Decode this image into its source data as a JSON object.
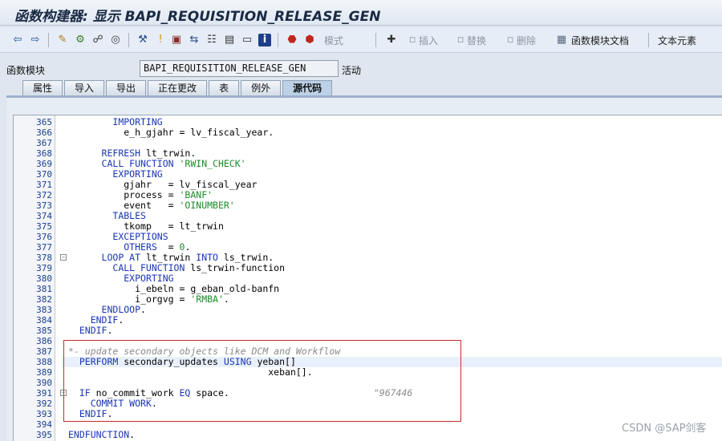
{
  "window": {
    "title": "函数构建器: 显示 BAPI_REQUISITION_RELEASE_GEN"
  },
  "toolbar": {
    "mode_label": "模式",
    "insert_label": "插入",
    "replace_label": "替换",
    "delete_label": "删除",
    "docs_label": "函数模块文档",
    "text_elements_label": "文本元素"
  },
  "header": {
    "field_label": "函数模块",
    "function_name": "BAPI_REQUISITION_RELEASE_GEN",
    "status": "活动"
  },
  "tabs": [
    {
      "label": "属性"
    },
    {
      "label": "导入"
    },
    {
      "label": "导出"
    },
    {
      "label": "正在更改"
    },
    {
      "label": "表"
    },
    {
      "label": "例外"
    },
    {
      "label": "源代码"
    }
  ],
  "active_tab": "源代码",
  "editor": {
    "line_numbers": [
      "365",
      "366",
      "367",
      "368",
      "369",
      "370",
      "371",
      "372",
      "373",
      "374",
      "375",
      "376",
      "377",
      "378",
      "379",
      "380",
      "381",
      "382",
      "383",
      "384",
      "385",
      "386",
      "387",
      "388",
      "389",
      "390",
      "391",
      "392",
      "393",
      "394",
      "395"
    ],
    "lines": [
      {
        "indent": "        ",
        "parts": [
          {
            "t": "IMPORTING",
            "c": "kw"
          }
        ]
      },
      {
        "indent": "          ",
        "parts": [
          {
            "t": "e_h_gjahr = lv_fiscal_year.",
            "c": ""
          }
        ]
      },
      {
        "indent": "",
        "parts": []
      },
      {
        "indent": "      ",
        "parts": [
          {
            "t": "REFRESH",
            "c": "kw"
          },
          {
            "t": " lt_trwin.",
            "c": ""
          }
        ]
      },
      {
        "indent": "      ",
        "parts": [
          {
            "t": "CALL FUNCTION",
            "c": "kw"
          },
          {
            "t": " ",
            "c": ""
          },
          {
            "t": "'RWIN_CHECK'",
            "c": "str"
          }
        ]
      },
      {
        "indent": "        ",
        "parts": [
          {
            "t": "EXPORTING",
            "c": "kw"
          }
        ]
      },
      {
        "indent": "          ",
        "parts": [
          {
            "t": "gjahr   = lv_fiscal_year",
            "c": ""
          }
        ]
      },
      {
        "indent": "          ",
        "parts": [
          {
            "t": "process = ",
            "c": ""
          },
          {
            "t": "'BANF'",
            "c": "str"
          }
        ]
      },
      {
        "indent": "          ",
        "parts": [
          {
            "t": "event   = ",
            "c": ""
          },
          {
            "t": "'OINUMBER'",
            "c": "str"
          }
        ]
      },
      {
        "indent": "        ",
        "parts": [
          {
            "t": "TABLES",
            "c": "kw"
          }
        ]
      },
      {
        "indent": "          ",
        "parts": [
          {
            "t": "tkomp   = lt_trwin",
            "c": ""
          }
        ]
      },
      {
        "indent": "        ",
        "parts": [
          {
            "t": "EXCEPTIONS",
            "c": "kw"
          }
        ]
      },
      {
        "indent": "          ",
        "parts": [
          {
            "t": "OTHERS",
            "c": "kw"
          },
          {
            "t": "  = ",
            "c": ""
          },
          {
            "t": "0",
            "c": "str"
          },
          {
            "t": ".",
            "c": ""
          }
        ]
      },
      {
        "indent": "      ",
        "parts": [
          {
            "t": "LOOP AT",
            "c": "kw"
          },
          {
            "t": " lt_trwin ",
            "c": ""
          },
          {
            "t": "INTO",
            "c": "kw"
          },
          {
            "t": " ls_trwin.",
            "c": ""
          }
        ]
      },
      {
        "indent": "        ",
        "parts": [
          {
            "t": "CALL FUNCTION",
            "c": "kw"
          },
          {
            "t": " ls_trwin-function",
            "c": ""
          }
        ]
      },
      {
        "indent": "          ",
        "parts": [
          {
            "t": "EXPORTING",
            "c": "kw"
          }
        ]
      },
      {
        "indent": "            ",
        "parts": [
          {
            "t": "i_ebeln = g_eban_old-banfn",
            "c": ""
          }
        ]
      },
      {
        "indent": "            ",
        "parts": [
          {
            "t": "i_orgvg = ",
            "c": ""
          },
          {
            "t": "'RMBA'",
            "c": "str"
          },
          {
            "t": ".",
            "c": ""
          }
        ]
      },
      {
        "indent": "      ",
        "parts": [
          {
            "t": "ENDLOOP",
            "c": "kw"
          },
          {
            "t": ".",
            "c": ""
          }
        ]
      },
      {
        "indent": "    ",
        "parts": [
          {
            "t": "ENDIF",
            "c": "kw"
          },
          {
            "t": ".",
            "c": ""
          }
        ]
      },
      {
        "indent": "  ",
        "parts": [
          {
            "t": "ENDIF",
            "c": "kw"
          },
          {
            "t": ".",
            "c": ""
          }
        ]
      },
      {
        "indent": "",
        "parts": []
      },
      {
        "indent": "",
        "parts": [
          {
            "t": "*- update secondary objects like DCM and Workflow",
            "c": "cm"
          }
        ]
      },
      {
        "indent": "  ",
        "parts": [
          {
            "t": "PERFORM",
            "c": "kw"
          },
          {
            "t": " secondary_updates ",
            "c": ""
          },
          {
            "t": "USING",
            "c": "kw"
          },
          {
            "t": " yeban[]",
            "c": ""
          }
        ]
      },
      {
        "indent": "                                    ",
        "parts": [
          {
            "t": "xeban[].",
            "c": ""
          }
        ]
      },
      {
        "indent": "",
        "parts": []
      },
      {
        "indent": "  ",
        "parts": [
          {
            "t": "IF",
            "c": "kw"
          },
          {
            "t": " no_commit_work ",
            "c": ""
          },
          {
            "t": "EQ",
            "c": "kw"
          },
          {
            "t": " space.                          ",
            "c": ""
          },
          {
            "t": "\"967446",
            "c": "cm"
          }
        ]
      },
      {
        "indent": "    ",
        "parts": [
          {
            "t": "COMMIT WORK",
            "c": "kw"
          },
          {
            "t": ".",
            "c": ""
          }
        ]
      },
      {
        "indent": "  ",
        "parts": [
          {
            "t": "ENDIF",
            "c": "kw"
          },
          {
            "t": ".",
            "c": ""
          }
        ]
      },
      {
        "indent": "",
        "parts": []
      },
      {
        "indent": "",
        "parts": [
          {
            "t": "ENDFUNCTION",
            "c": "kw"
          },
          {
            "t": ".",
            "c": ""
          }
        ]
      }
    ]
  },
  "watermark": "CSDN @SAP剑客",
  "colors": {
    "keyword": "#1a35b4",
    "string": "#1d8a2a",
    "comment": "#8a8a8a",
    "highlight_box": "#cc2a2a",
    "line_number": "#1c3f8f"
  }
}
